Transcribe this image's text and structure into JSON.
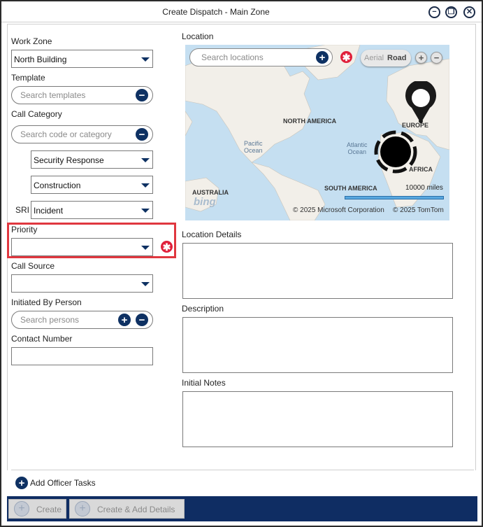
{
  "window": {
    "title": "Create Dispatch - Main Zone",
    "minimize_glyph": "−",
    "restore_glyph": "❐",
    "close_glyph": "✕"
  },
  "form": {
    "work_zone_label": "Work Zone",
    "work_zone_value": "North Building",
    "template_label": "Template",
    "template_placeholder": "Search templates",
    "call_category_label": "Call Category",
    "call_category_placeholder": "Search code or category",
    "category_1_value": "Security Response",
    "category_2_value": "Construction",
    "sri_label": "SRI",
    "sri_value": "Incident",
    "priority_label": "Priority",
    "priority_value": "",
    "call_source_label": "Call Source",
    "call_source_value": "",
    "initiated_by_label": "Initiated By Person",
    "initiated_by_placeholder": "Search persons",
    "contact_number_label": "Contact Number",
    "contact_number_value": ""
  },
  "location": {
    "label": "Location",
    "search_placeholder": "Search locations",
    "map_mode_aerial": "Aerial",
    "map_mode_road": "Road",
    "map_mode_selected": "Road",
    "labels": {
      "north_america": "NORTH AMERICA",
      "europe": "EUROPE",
      "africa": "AFRICA",
      "south_america": "SOUTH AMERICA",
      "australia": "AUSTRALIA",
      "pacific_ocean": "Pacific\nOcean",
      "atlantic_ocean": "Atlantic\nOcean"
    },
    "scale": "10000 miles",
    "bing_logo": "bing",
    "copyright_microsoft": "© 2025 Microsoft Corporation",
    "copyright_tomtom": "© 2025 TomTom",
    "details_label": "Location Details"
  },
  "description": {
    "label": "Description"
  },
  "notes": {
    "label": "Initial Notes"
  },
  "tasks": {
    "add_label": "Add Officer Tasks"
  },
  "footer": {
    "create_label": "Create",
    "create_add_label": "Create & Add Details"
  },
  "colors": {
    "accent": "#0e3163",
    "footer_bg": "#0f2d63",
    "required": "#e0203b",
    "highlight": "#e0373f",
    "map_water": "#c5dff1",
    "map_land": "#f2efe9"
  }
}
